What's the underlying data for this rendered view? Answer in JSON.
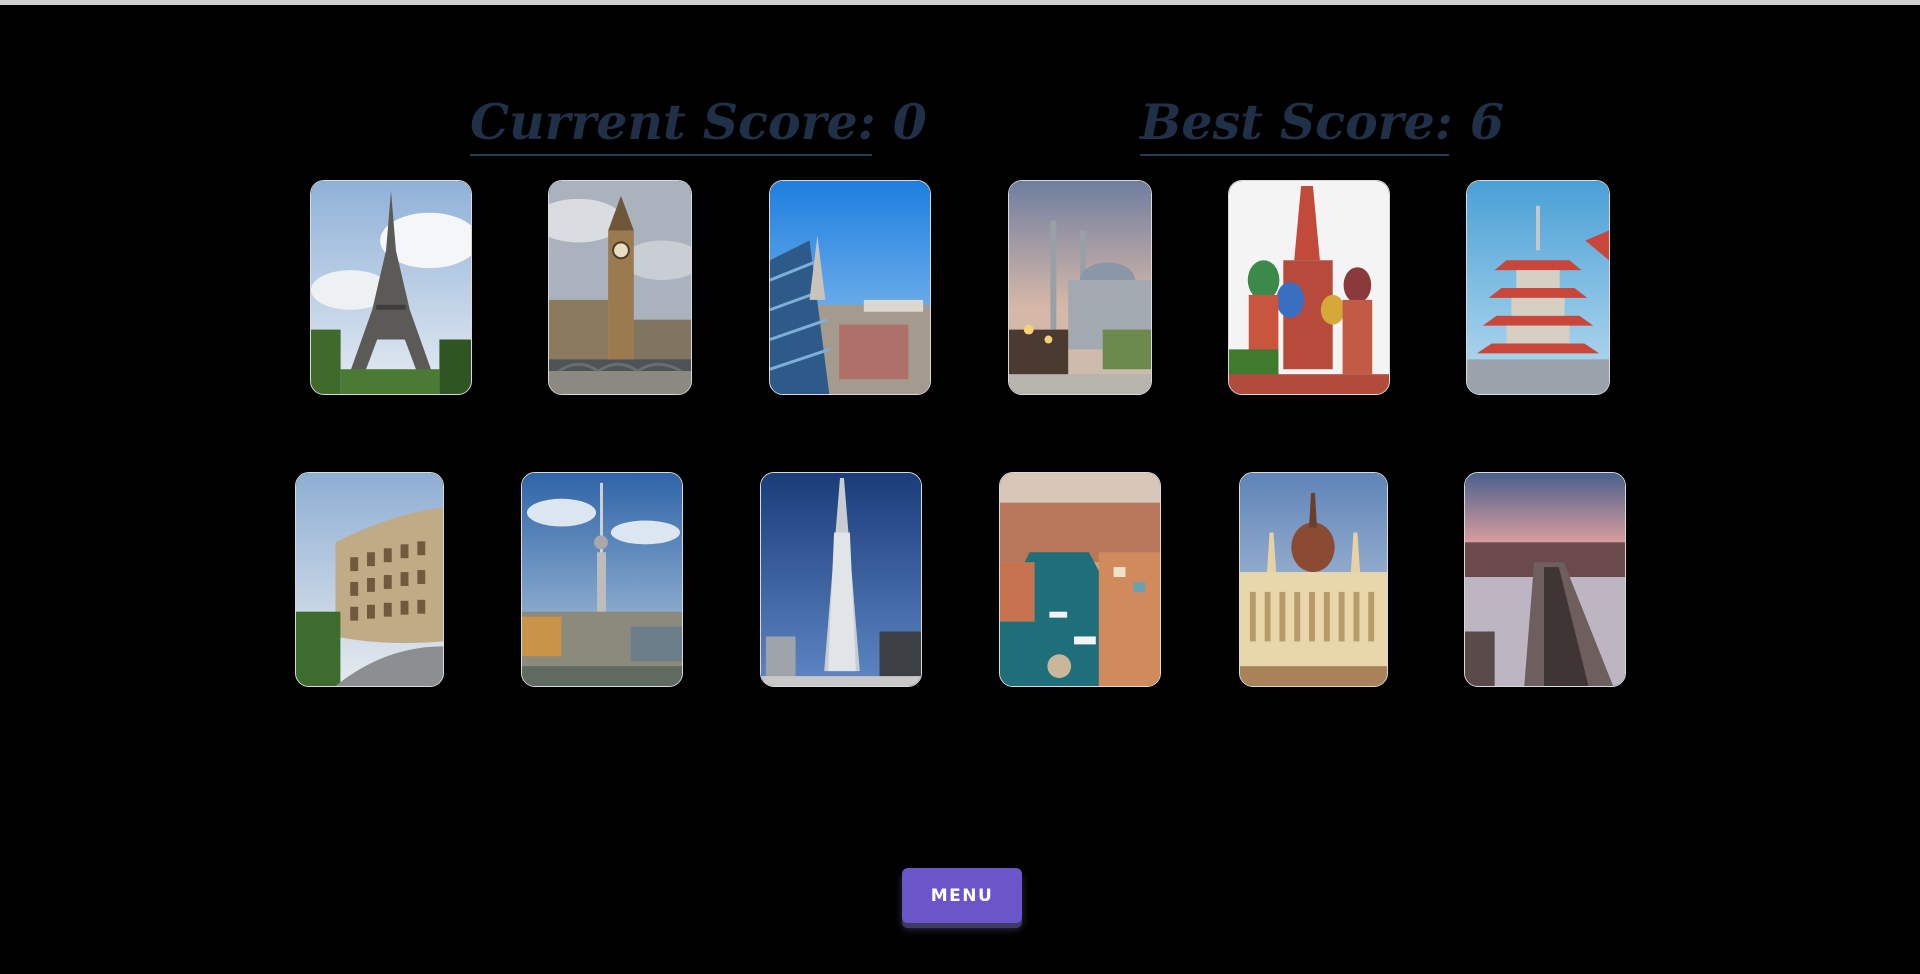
{
  "scores": {
    "current_label": "Current Score: 0",
    "best_label": "Best Score: 6"
  },
  "cards": [
    {
      "name": "eiffel-tower-card",
      "landmark": "Eiffel Tower"
    },
    {
      "name": "big-ben-card",
      "landmark": "Big Ben"
    },
    {
      "name": "st-stephens-cathedral-card",
      "landmark": "St. Stephen's Cathedral"
    },
    {
      "name": "blue-mosque-card",
      "landmark": "Blue Mosque"
    },
    {
      "name": "st-basils-cathedral-card",
      "landmark": "St. Basil's Cathedral"
    },
    {
      "name": "japanese-pagoda-card",
      "landmark": "Japanese Pagoda"
    },
    {
      "name": "colosseum-card",
      "landmark": "Colosseum"
    },
    {
      "name": "berlin-tv-tower-card",
      "landmark": "Berlin TV Tower"
    },
    {
      "name": "burj-khalifa-card",
      "landmark": "Burj Khalifa"
    },
    {
      "name": "copenhagen-harbor-card",
      "landmark": "Copenhagen Nyhavn"
    },
    {
      "name": "hungarian-parliament-card",
      "landmark": "Hungarian Parliament"
    },
    {
      "name": "charles-bridge-card",
      "landmark": "Charles Bridge"
    }
  ],
  "menu": {
    "label": "MENU"
  },
  "colors": {
    "background": "#000000",
    "score_text": "#1f3048",
    "menu_button": "#6a55c9"
  }
}
